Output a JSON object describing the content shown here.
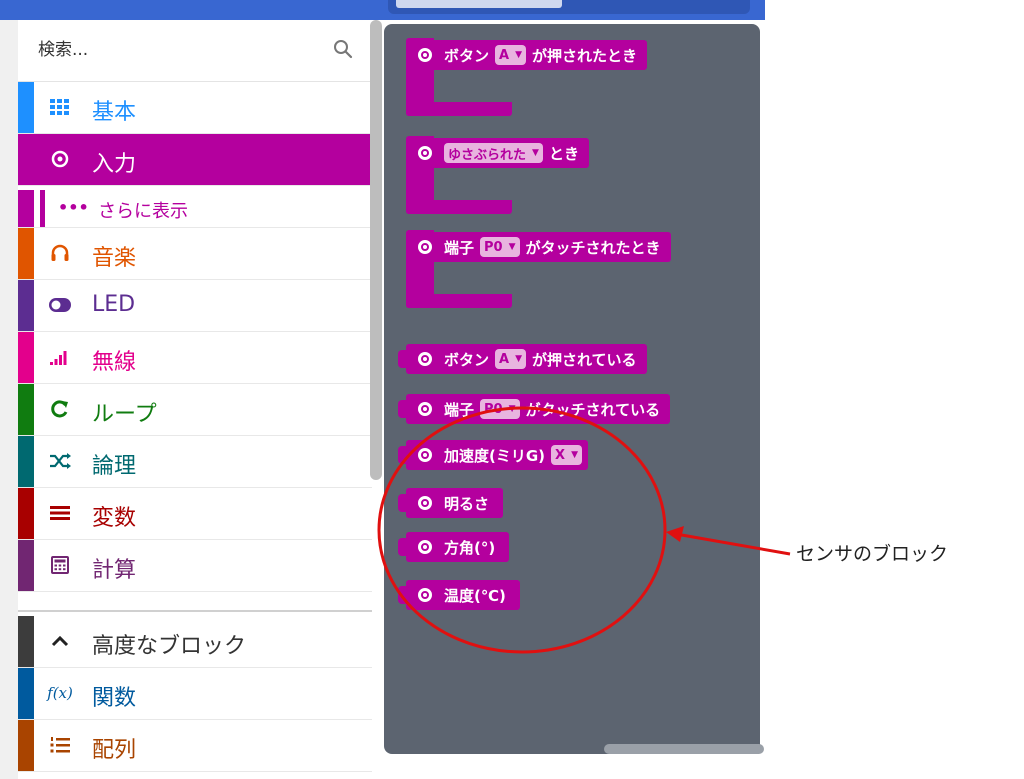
{
  "search": {
    "placeholder": "検索..."
  },
  "colors": {
    "input": "#b4009e",
    "flyout_bg": "#5c6470",
    "callout": "#e01010"
  },
  "categories": [
    {
      "label": "基本",
      "icon": "grid-icon",
      "color": "#1e90ff"
    },
    {
      "label": "入力",
      "icon": "target-icon",
      "color": "#b4009e",
      "selected": true
    },
    {
      "label": "音楽",
      "icon": "headphones-icon",
      "color": "#e05500"
    },
    {
      "label": "LED",
      "icon": "toggle-icon",
      "color": "#5c2d91"
    },
    {
      "label": "無線",
      "icon": "signal-icon",
      "color": "#e3008c"
    },
    {
      "label": "ループ",
      "icon": "loop-icon",
      "color": "#107c10"
    },
    {
      "label": "論理",
      "icon": "shuffle-icon",
      "color": "#006970"
    },
    {
      "label": "変数",
      "icon": "list-icon",
      "color": "#a80000"
    },
    {
      "label": "計算",
      "icon": "calculator-icon",
      "color": "#712672"
    }
  ],
  "submenu": {
    "label": "さらに表示",
    "icon": "more-icon"
  },
  "advanced": [
    {
      "label": "高度なブロック",
      "icon": "chevron-up-icon",
      "color": "#3c3c3c"
    },
    {
      "label": "関数",
      "icon": "function-icon",
      "color": "#005a9e"
    },
    {
      "label": "配列",
      "icon": "ordered-list-icon",
      "color": "#a94400"
    }
  ],
  "blocks": {
    "hat1": {
      "pre": "ボタン",
      "drop": "A",
      "post": "が押されたとき"
    },
    "hat2": {
      "drop": "ゆさぶられた",
      "post": "とき"
    },
    "hat3": {
      "pre": "端子",
      "drop": "P0",
      "post": "がタッチされたとき"
    },
    "rep1": {
      "pre": "ボタン",
      "drop": "A",
      "post": "が押されている"
    },
    "rep2": {
      "pre": "端子",
      "drop": "P0",
      "post": "がタッチされている"
    },
    "rep3": {
      "pre": "加速度(ミリG)",
      "drop": "X"
    },
    "rep4": {
      "pre": "明るさ"
    },
    "rep5": {
      "pre": "方角(°)"
    },
    "rep6": {
      "pre": "温度(℃)"
    }
  },
  "annotation": {
    "label": "センサのブロック"
  }
}
